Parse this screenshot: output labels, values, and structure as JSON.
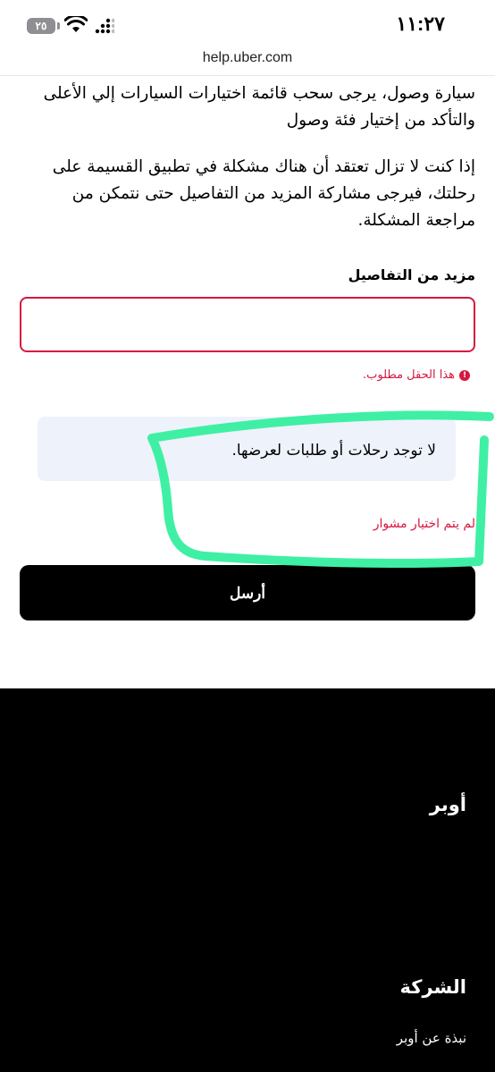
{
  "status_bar": {
    "time": "١١:٢٧",
    "battery": "٢٥",
    "icons": [
      "battery-icon",
      "wifi-icon",
      "cellular-signal-icon"
    ]
  },
  "browser": {
    "url": "help.uber.com"
  },
  "content": {
    "paragraph1": "سيارة وصول، يرجى سحب قائمة اختيارات السيارات إلي الأعلى والتأكد من إختيار فئة وصول",
    "paragraph2": "إذا كنت لا تزال تعتقد أن هناك مشكلة في تطبيق القسيمة على رحلتك، فيرجى مشاركة المزيد من التفاصيل حتى نتمكن من مراجعة المشكلة.",
    "details_label": "مزيد من التفاصيل",
    "details_value": "",
    "required_error": "هذا الحقل مطلوب.",
    "no_trips_notice": "لا توجد رحلات أو طلبات لعرضها.",
    "no_trip_selected_error": "لم يتم اختيار مشوار",
    "submit_label": "أرسل"
  },
  "footer": {
    "brand": "أوبر",
    "section_company": "الشركة",
    "link_about": "نبذة عن أوبر"
  },
  "colors": {
    "error": "#d6183f",
    "highlight_stroke": "#3ff0a4",
    "notice_bg": "#eef2fb",
    "button_bg": "#000000",
    "footer_bg": "#000000"
  }
}
